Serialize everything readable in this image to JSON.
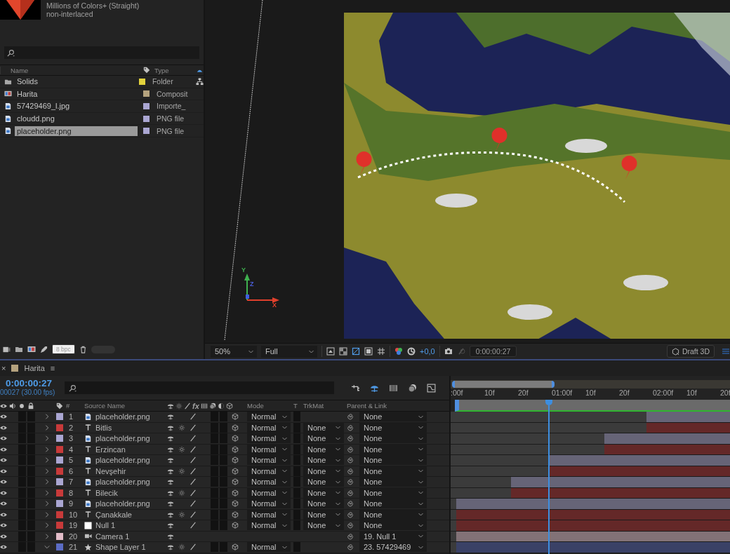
{
  "project": {
    "thumbnail_info": [
      "Millions of Colors+ (Straight)",
      "non-interlaced"
    ],
    "columns": {
      "name": "Name",
      "type": "Type"
    },
    "items": [
      {
        "name": "Solids",
        "kind": "folder",
        "color": "#e2d23c",
        "type": "Folder",
        "selected": false
      },
      {
        "name": "Harita",
        "kind": "comp",
        "color": "#b4a27e",
        "type": "Composit",
        "selected": false
      },
      {
        "name": "57429469_l.jpg",
        "kind": "image",
        "color": "#aaa6d2",
        "type": "Importe_",
        "selected": false
      },
      {
        "name": "cloudd.png",
        "kind": "image",
        "color": "#aaa6d2",
        "type": "PNG file",
        "selected": false
      },
      {
        "name": "placeholder.png",
        "kind": "image",
        "color": "#aaa6d2",
        "type": "PNG file",
        "selected": true
      }
    ],
    "bit_depth": "8 bpc"
  },
  "viewer": {
    "axes": [
      "Y",
      "Z",
      "X"
    ],
    "zoom": "50%",
    "resolution": "Full",
    "exposure": "+0,0",
    "timecode": "0:00:00:27",
    "renderer": "Draft 3D"
  },
  "timeline": {
    "tab": {
      "close": "×",
      "title": "Harita",
      "color": "#b4a27e",
      "menu": "≡"
    },
    "time": "0:00:00:27",
    "frame_info": "00027 (30.00 fps)",
    "columns": {
      "number": "#",
      "source": "Source Name",
      "fx": "fx",
      "mode": "Mode",
      "t": "T",
      "track_matte": "TrkMat",
      "parent": "Parent & Link"
    },
    "ruler": [
      ":00f",
      "10f",
      "20f",
      "01:00f",
      "10f",
      "20f",
      "02:00f",
      "10f",
      "20f"
    ],
    "playhead": {
      "level": 0.35
    },
    "layers": [
      {
        "number": "1",
        "name": "placeholder.png",
        "kind": "image",
        "color": "#aaa6d2",
        "expanded": false,
        "mode": "Normal",
        "parent": "None",
        "level": 0.3
      },
      {
        "number": "2",
        "name": "Bitlis",
        "kind": "text",
        "color": "#c83a3a",
        "expanded": false,
        "mode": "Normal",
        "track_matte": "None",
        "parent": "None",
        "level": 0.3
      },
      {
        "number": "3",
        "name": "placeholder.png",
        "kind": "image",
        "color": "#aaa6d2",
        "expanded": false,
        "mode": "Normal",
        "track_matte": "None",
        "parent": "None",
        "level": 0.45
      },
      {
        "number": "4",
        "name": "Erzincan",
        "kind": "text",
        "color": "#c83a3a",
        "expanded": false,
        "mode": "Normal",
        "track_matte": "None",
        "parent": "None",
        "level": 0.45
      },
      {
        "number": "5",
        "name": "placeholder.png",
        "kind": "image",
        "color": "#aaa6d2",
        "expanded": false,
        "mode": "Normal",
        "track_matte": "None",
        "parent": "None",
        "level": 0.65
      },
      {
        "number": "6",
        "name": "Nevşehir",
        "kind": "text",
        "color": "#c83a3a",
        "expanded": false,
        "mode": "Normal",
        "track_matte": "None",
        "parent": "None",
        "level": 0.65
      },
      {
        "number": "7",
        "name": "placeholder.png",
        "kind": "image",
        "color": "#aaa6d2",
        "expanded": false,
        "mode": "Normal",
        "track_matte": "None",
        "parent": "None",
        "level": 0.785
      },
      {
        "number": "8",
        "name": "Bilecik",
        "kind": "text",
        "color": "#c83a3a",
        "expanded": false,
        "mode": "Normal",
        "track_matte": "None",
        "parent": "None",
        "level": 0.785
      },
      {
        "number": "9",
        "name": "placeholder.png",
        "kind": "image",
        "color": "#aaa6d2",
        "expanded": false,
        "mode": "Normal",
        "track_matte": "None",
        "parent": "None",
        "level": 0.98
      },
      {
        "number": "10",
        "name": "Çanakkale",
        "kind": "text",
        "color": "#c83a3a",
        "expanded": false,
        "mode": "Normal",
        "track_matte": "None",
        "parent": "None",
        "level": 0.98
      },
      {
        "number": "19",
        "name": "Null 1",
        "kind": "null",
        "color": "#c83a3a",
        "expanded": false,
        "mode": "Normal",
        "track_matte": "None",
        "parent": "None",
        "level": 0.98
      },
      {
        "number": "20",
        "name": "Camera 1",
        "kind": "camera",
        "color": "#e2bcc8",
        "expanded": false,
        "parent": "19. Null 1",
        "level": 0.98
      },
      {
        "number": "21",
        "name": "Shape Layer 1",
        "kind": "shape",
        "color": "#5b6cc4",
        "expanded": true,
        "mode": "Normal",
        "parent": "23. 57429469",
        "level": 0.98
      }
    ]
  }
}
